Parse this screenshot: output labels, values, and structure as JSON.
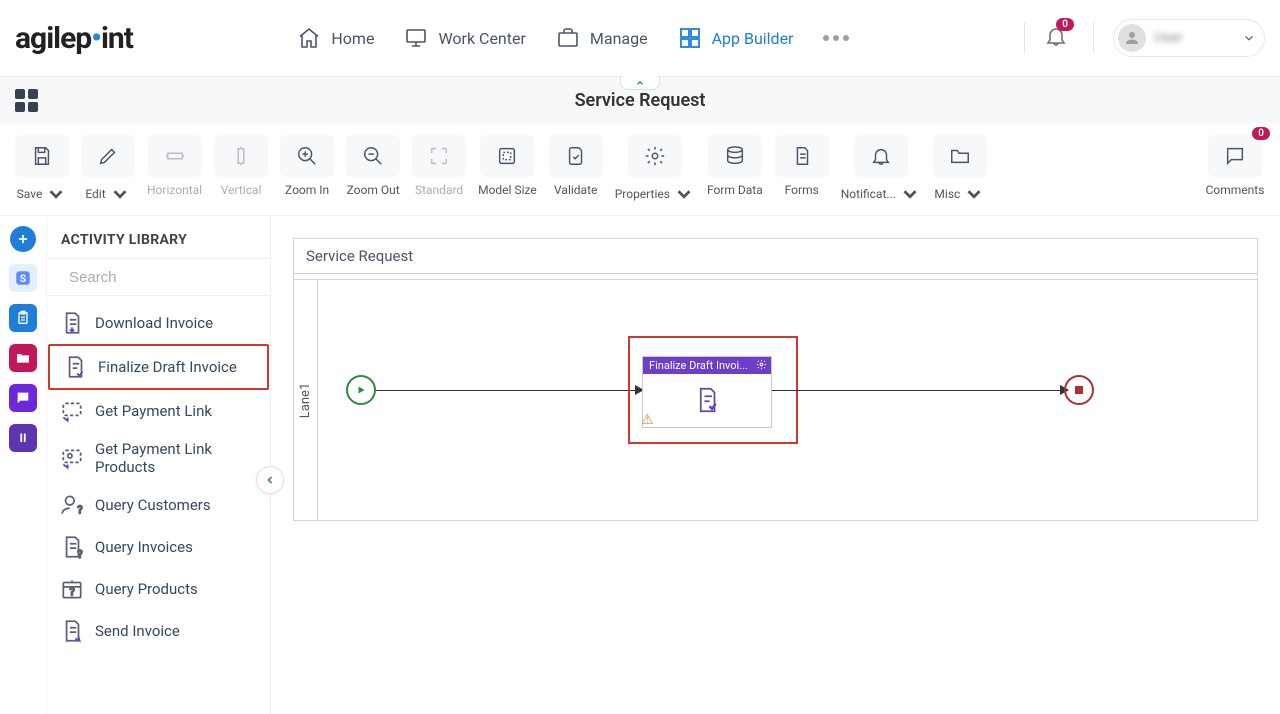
{
  "header": {
    "logo_text": "agilepoint",
    "nav": {
      "home": "Home",
      "work_center": "Work Center",
      "manage": "Manage",
      "app_builder": "App Builder"
    },
    "notification_count": "0",
    "user_name": "User"
  },
  "subheader": {
    "title": "Service Request"
  },
  "toolbar": {
    "save": "Save",
    "edit": "Edit",
    "horizontal": "Horizontal",
    "vertical": "Vertical",
    "zoom_in": "Zoom In",
    "zoom_out": "Zoom Out",
    "standard": "Standard",
    "model_size": "Model Size",
    "validate": "Validate",
    "properties": "Properties",
    "form_data": "Form Data",
    "forms": "Forms",
    "notifications": "Notificat...",
    "misc": "Misc",
    "comments": "Comments",
    "comments_count": "0"
  },
  "sidebar": {
    "title": "ACTIVITY LIBRARY",
    "search_placeholder": "Search",
    "items": [
      {
        "label": "Download Invoice"
      },
      {
        "label": "Finalize Draft Invoice"
      },
      {
        "label": "Get Payment Link"
      },
      {
        "label": "Get Payment Link Products"
      },
      {
        "label": "Query Customers"
      },
      {
        "label": "Query Invoices"
      },
      {
        "label": "Query Products"
      },
      {
        "label": "Send Invoice"
      }
    ]
  },
  "canvas": {
    "title": "Service Request",
    "lane_label": "Lane1",
    "activity_title": "Finalize Draft Invoi..."
  },
  "rail": {
    "ii_label": "II"
  }
}
